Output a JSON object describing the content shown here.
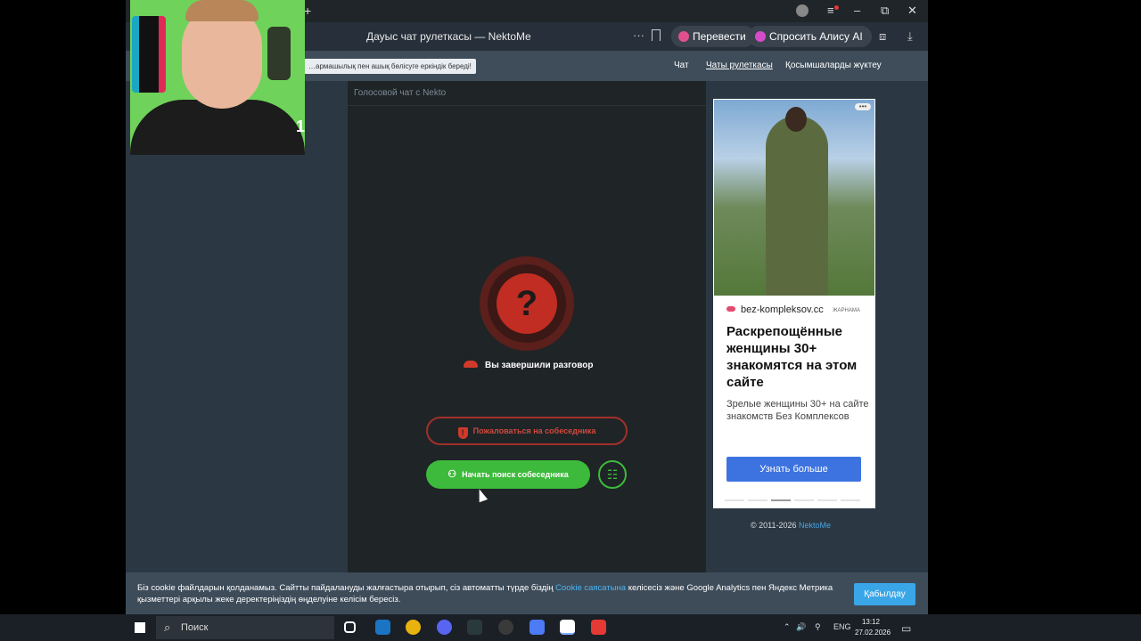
{
  "browser": {
    "tab_title": "Дауыс чат рулеткасы — NektoMe",
    "translate_button": "Перевести",
    "alice_button": "Спросить Алису AI",
    "new_tab_symbol": "+",
    "minimize_symbol": "–",
    "restore_symbol": "⧉",
    "close_symbol": "✕",
    "menu_symbol": "≡",
    "more_symbol": "···",
    "download_symbol": "⤓",
    "collections_symbol": "⧈"
  },
  "site_header": {
    "hint": "…армашылық пен ашық бөлісуге еркіндік береді!",
    "nav": [
      "Чат",
      "Чаты рулеткасы",
      "Қосымшаларды жүктеу"
    ]
  },
  "chat": {
    "panel_title": "Голосовой чат с Nekto",
    "question_mark": "?",
    "status": "Вы завершили разговор",
    "report_button": "Пожаловаться на собеседника",
    "report_icon_glyph": "!",
    "search_button": "Начать поиск собеседника",
    "search_icon_glyph": "⚇",
    "settings_icon_glyph": "☷"
  },
  "ad": {
    "domain": "bez-kompleksov.cc",
    "label": "ЖАРНАМА",
    "headline": "Раскрепощённые женщины 30+ знакомятся на этом сайте",
    "body": "Зрелые женщины 30+ на сайте знакомств Без Комплексов",
    "cta": "Узнать больше",
    "more_glyph": "•••",
    "carousel_active_index": 2,
    "carousel_count": 6
  },
  "footer": {
    "copyright": "© 2011-2026",
    "brand": "NektoMe"
  },
  "cookie": {
    "text_before_link": "Біз cookie файлдарын қолданамыз. Сайтты пайдалануды жалғастыра отырып, сіз автоматты түрде біздің",
    "link": "Cookie саясатына",
    "text_after_link": "келісесіз және Google Analytics пен Яндекс Метрика қызметтері арқылы жеке деректеріңіздің өңделуіне келісім бересіз.",
    "accept_button": "Қабылдау"
  },
  "webcam": {
    "overlay_number": "1"
  },
  "taskbar": {
    "search_placeholder": "Поиск",
    "language": "ENG",
    "time": "13:12",
    "date": "27.02.2026",
    "apps": [
      {
        "name": "task-view-icon",
        "color": "#ffffff"
      },
      {
        "name": "steam-icon",
        "color": "#1b74c4"
      },
      {
        "name": "chrome-icon",
        "color": "#e8b30f"
      },
      {
        "name": "discord-icon",
        "color": "#5865f2"
      },
      {
        "name": "terminal-icon",
        "color": "#2a3a3a"
      },
      {
        "name": "obs-icon",
        "color": "#3a3a3a"
      },
      {
        "name": "roblox-icon",
        "color": "#4d7bf3"
      },
      {
        "name": "yandex-browser-icon",
        "color": "#ffffff"
      },
      {
        "name": "youtube-icon",
        "color": "#e53935"
      }
    ],
    "tray_up_glyph": "⌃",
    "tray_volume_glyph": "🔊",
    "tray_network_glyph": "⚲",
    "notifications_glyph": "▭"
  }
}
